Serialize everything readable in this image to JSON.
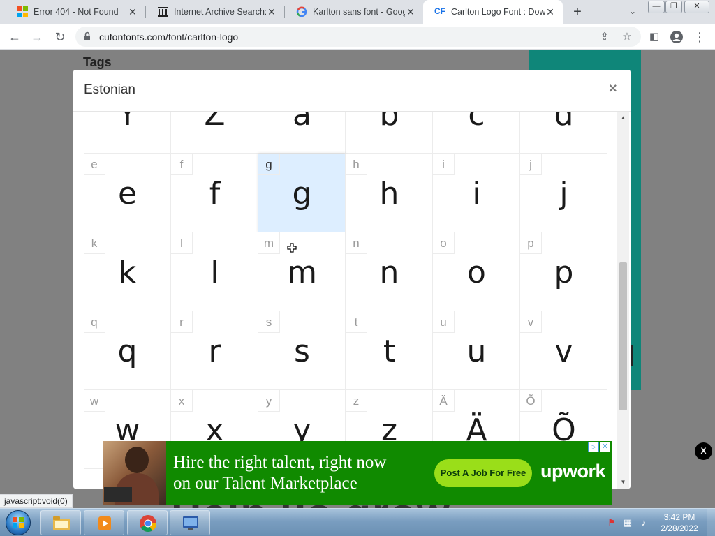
{
  "browser": {
    "tabs": [
      {
        "title": "Error 404 - Not Found",
        "favicon": "microsoft-icon",
        "active": false
      },
      {
        "title": "Internet Archive Search: s",
        "favicon": "internet-archive-icon",
        "active": false
      },
      {
        "title": "Karlton sans font - Googl",
        "favicon": "google-icon",
        "active": false
      },
      {
        "title": "Carlton Logo Font : Down",
        "favicon": "cufonfonts-icon",
        "favicon_text": "CF",
        "active": true
      }
    ],
    "url": "cufonfonts.com/font/carlton-logo",
    "status_url": "javascript:void(0)"
  },
  "page": {
    "heading": "Tags",
    "background_text": "Help us grow"
  },
  "modal": {
    "title": "Estonian",
    "close_label": "×",
    "characters": [
      {
        "label": "",
        "glyph": "Y"
      },
      {
        "label": "",
        "glyph": "Z"
      },
      {
        "label": "",
        "glyph": "a"
      },
      {
        "label": "",
        "glyph": "b"
      },
      {
        "label": "",
        "glyph": "c"
      },
      {
        "label": "",
        "glyph": "d"
      },
      {
        "label": "e",
        "glyph": "e"
      },
      {
        "label": "f",
        "glyph": "f"
      },
      {
        "label": "g",
        "glyph": "g"
      },
      {
        "label": "h",
        "glyph": "h"
      },
      {
        "label": "i",
        "glyph": "i"
      },
      {
        "label": "j",
        "glyph": "j"
      },
      {
        "label": "k",
        "glyph": "k"
      },
      {
        "label": "l",
        "glyph": "l"
      },
      {
        "label": "m",
        "glyph": "m"
      },
      {
        "label": "n",
        "glyph": "n"
      },
      {
        "label": "o",
        "glyph": "o"
      },
      {
        "label": "p",
        "glyph": "p"
      },
      {
        "label": "q",
        "glyph": "q"
      },
      {
        "label": "r",
        "glyph": "r"
      },
      {
        "label": "s",
        "glyph": "s"
      },
      {
        "label": "t",
        "glyph": "t"
      },
      {
        "label": "u",
        "glyph": "u"
      },
      {
        "label": "v",
        "glyph": "v"
      },
      {
        "label": "w",
        "glyph": "w"
      },
      {
        "label": "x",
        "glyph": "x"
      },
      {
        "label": "y",
        "glyph": "y"
      },
      {
        "label": "z",
        "glyph": "z"
      },
      {
        "label": "Ä",
        "glyph": "Ä"
      },
      {
        "label": "Õ",
        "glyph": "Õ"
      }
    ],
    "hovered_index": 8
  },
  "ad": {
    "line1": "Hire the right talent, right now",
    "line2": "on our Talent Marketplace",
    "cta": "Post A Job For Free",
    "brand": "upwork",
    "choices_label": "▷",
    "close_label": "✕",
    "dismiss_label": "X"
  },
  "taskbar": {
    "time": "3:42 PM",
    "date": "2/28/2022",
    "items": [
      "windows-explorer",
      "media-player",
      "chrome",
      "remote-desktop"
    ]
  },
  "colors": {
    "accent_teal": "#0f8679",
    "upwork_green": "#108a00",
    "upwork_cta": "#9ade19",
    "hover_cell": "#ddeeff"
  }
}
